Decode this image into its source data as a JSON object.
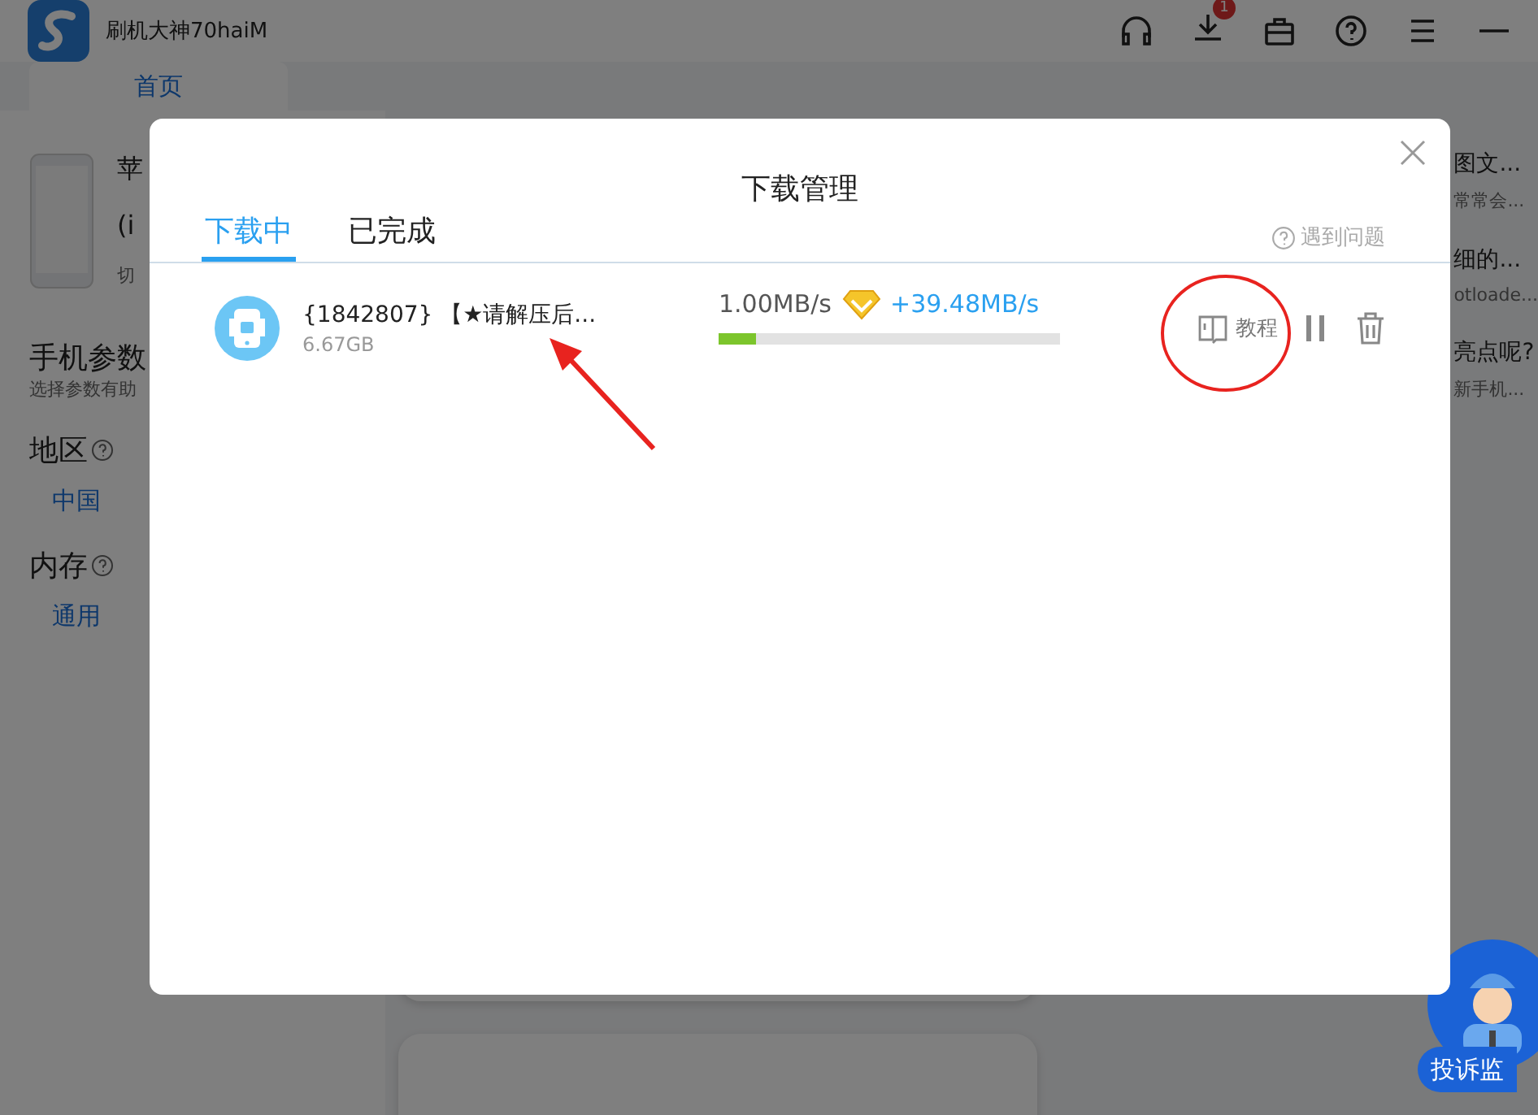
{
  "window": {
    "title": "刷机大神70haiM",
    "download_badge": "1"
  },
  "nav_tabs": [
    {
      "label": "首页",
      "selected": true
    }
  ],
  "device": {
    "name": "苹",
    "model": "(i",
    "switch": "切"
  },
  "params": {
    "title": "手机参数",
    "hint": "选择参数有助",
    "fields": [
      {
        "label": "地区",
        "value": "中国"
      },
      {
        "label": "内存",
        "value": "通用"
      }
    ]
  },
  "articles": [
    {
      "title": "图文...",
      "subtitle": "常常会..."
    },
    {
      "title": "细的...",
      "subtitle": "otloade..."
    },
    {
      "title": "亮点呢?",
      "subtitle": "新手机..."
    }
  ],
  "complaint": {
    "label": "投诉监"
  },
  "dialog": {
    "title": "下载管理",
    "tabs": [
      {
        "label": "下载中",
        "selected": true
      },
      {
        "label": "已完成",
        "selected": false
      }
    ],
    "help": "遇到问题",
    "downloads": [
      {
        "name": "{1842807} 【★请解压后...",
        "size": "6.67GB",
        "speed": "1.00MB/s",
        "boost": "+39.48MB/s",
        "level": 0.11,
        "tutorial": "教程"
      }
    ]
  }
}
